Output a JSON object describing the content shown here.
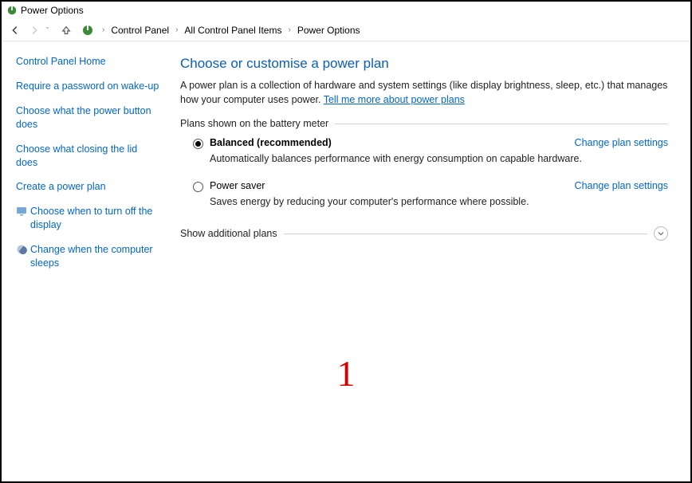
{
  "window": {
    "title": "Power Options"
  },
  "breadcrumb": {
    "items": [
      "Control Panel",
      "All Control Panel Items",
      "Power Options"
    ]
  },
  "sidebar": {
    "home": "Control Panel Home",
    "links": [
      "Require a password on wake-up",
      "Choose what the power button does",
      "Choose what closing the lid does",
      "Create a power plan",
      "Choose when to turn off the display",
      "Change when the computer sleeps"
    ]
  },
  "main": {
    "title": "Choose or customise a power plan",
    "intro_text": "A power plan is a collection of hardware and system settings (like display brightness, sleep, etc.) that manages how your computer uses power. ",
    "intro_link": "Tell me more about power plans",
    "plans_header": "Plans shown on the battery meter",
    "plans": [
      {
        "name": "Balanced (recommended)",
        "desc": "Automatically balances performance with energy consumption on capable hardware.",
        "selected": true,
        "change_label": "Change plan settings"
      },
      {
        "name": "Power saver",
        "desc": "Saves energy by reducing your computer's performance where possible.",
        "selected": false,
        "change_label": "Change plan settings"
      }
    ],
    "additional_label": "Show additional plans"
  },
  "overlay": {
    "marker": "1"
  }
}
